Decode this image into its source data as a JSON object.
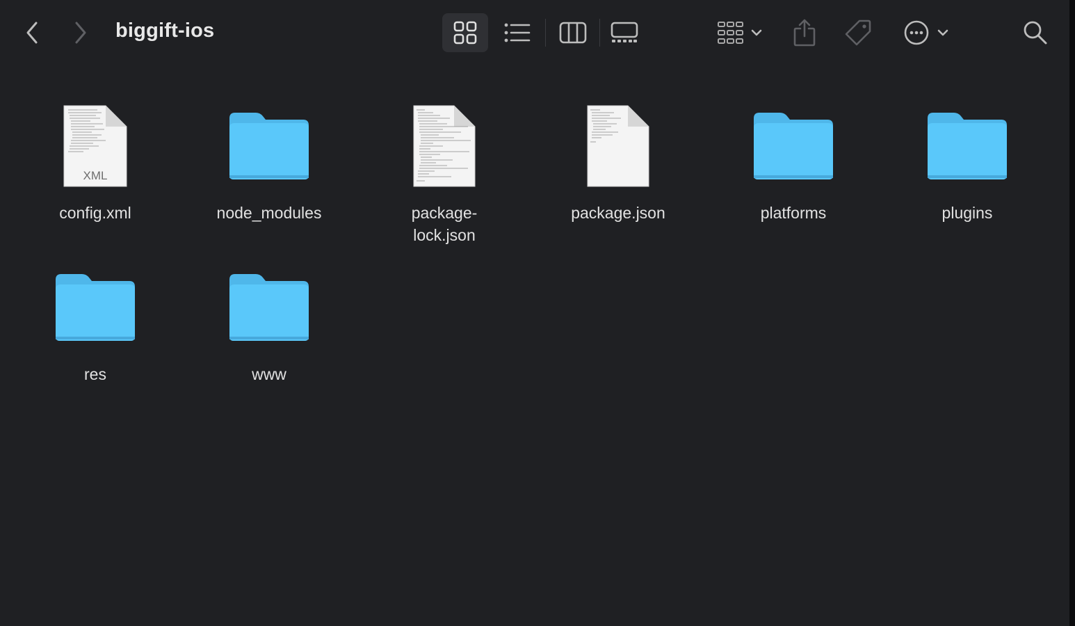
{
  "window": {
    "title": "biggift-ios"
  },
  "toolbar": {
    "back_icon": "chevron-left-icon",
    "forward_icon": "chevron-right-icon",
    "view_icons": [
      "icon-view-icon",
      "list-view-icon",
      "column-view-icon",
      "gallery-view-icon"
    ],
    "group_icon": "group-icon",
    "share_icon": "share-icon",
    "tag_icon": "tag-icon",
    "more_icon": "ellipsis-circle-icon",
    "search_icon": "search-icon"
  },
  "colors": {
    "background": "#1f2023",
    "folder": "#5ac8fa",
    "folder_tab": "#4fb7ea",
    "file_page": "#f4f4f4",
    "text": "#e2e2e2"
  },
  "items": [
    {
      "name": "config.xml",
      "kind": "file",
      "badge": "XML"
    },
    {
      "name": "node_modules",
      "kind": "folder"
    },
    {
      "name": "package-lock.json",
      "kind": "file",
      "display": "package-\nlock.json"
    },
    {
      "name": "package.json",
      "kind": "file"
    },
    {
      "name": "platforms",
      "kind": "folder"
    },
    {
      "name": "plugins",
      "kind": "folder"
    },
    {
      "name": "res",
      "kind": "folder"
    },
    {
      "name": "www",
      "kind": "folder"
    }
  ]
}
